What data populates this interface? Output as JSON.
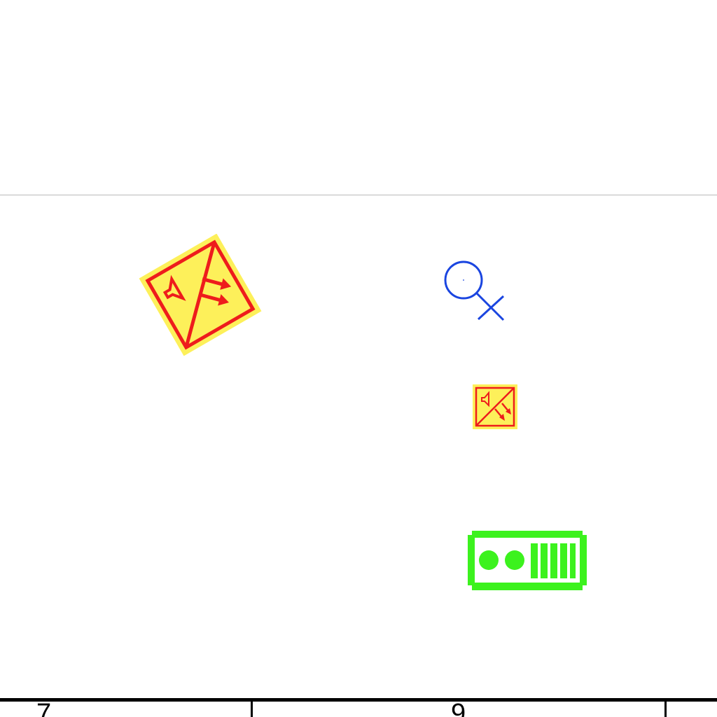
{
  "symbols": [
    {
      "name": "speaker-arrows-sign",
      "colors": {
        "fill": "#fdf05a",
        "stroke": "#ee1c1c"
      },
      "rotation_deg": -30
    },
    {
      "name": "female-marker",
      "colors": {
        "stroke": "#1a45e0"
      }
    },
    {
      "name": "speaker-arrows-sign-small",
      "colors": {
        "fill": "#fdf05a",
        "stroke": "#ee1c1c"
      }
    },
    {
      "name": "battery-indicator",
      "colors": {
        "stroke": "#3cf21e"
      }
    }
  ],
  "bottom_ruler": {
    "labels": [
      "7",
      "9"
    ]
  }
}
